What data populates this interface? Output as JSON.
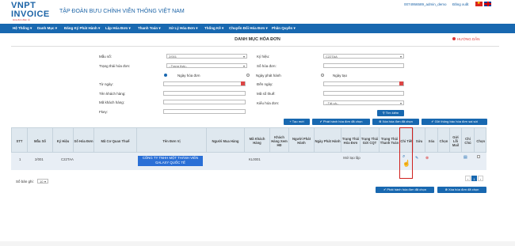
{
  "header": {
    "logo_line1": "VNPT",
    "logo_line2": "INVOICE",
    "logo_sub": "Hóa đơn điện tử",
    "company": "TẬP ĐOÀN BƯU CHÍNH VIỄN THÔNG VIỆT NAM",
    "user": "0074956589_admin_demo",
    "logout": "Đăng xuất"
  },
  "nav": {
    "items": [
      "Hệ Thống ▾",
      "Danh Mục ▾",
      "Đăng Ký Phát Hành ▾",
      "Lập Hóa Đơn ▾",
      "Thanh Toán ▾",
      "Xử Lý Hóa Đơn ▾",
      "Thống Kê ▾",
      "Chuyển Đổi Hóa Đơn ▾",
      "Phân Quyền ▾"
    ]
  },
  "page": {
    "title": "DANH MỤC HÓA ĐƠN",
    "help": "HƯỚNG DẪN"
  },
  "form": {
    "mau_so_label": "Mẫu số:",
    "mau_so_value": "2/001",
    "trang_thai_label": "Trạng thái hóa đơn:",
    "trang_thai_value": "--Trạng thái--",
    "radio_ngay_hoa_don": "Ngày hóa đơn",
    "radio_ngay_phat_hanh": "Ngày phát hành",
    "radio_ngay_tao": "Ngày tạo",
    "tu_ngay_label": "Từ ngày:",
    "ten_khach_hang_label": "Tên khách hàng:",
    "ma_khach_hang_label": "Mã khách hàng:",
    "fkey_label": "Fkey:",
    "ky_hieu_label": "Ký hiệu:",
    "ky_hieu_value": "C22TAA",
    "so_hoa_don_label": "Số hóa đơn:",
    "den_ngay_label": "Đến ngày:",
    "ma_so_thue_label": "Mã số thuế:",
    "kieu_hoa_don_label": "Kiểu hóa đơn:",
    "kieu_hoa_don_value": "--Tất cả--",
    "search_button": "Tìm kiếm"
  },
  "actions": {
    "tao_moi": "Tạo mới",
    "phat_hanh_da_chon": "Phát hành hóa đơn đã chọn",
    "xoa_da_chon": "Xóa hóa đơn đã chọn",
    "gui_thong_bao": "Gửi thông báo hóa đơn sai sót"
  },
  "table": {
    "headers": [
      "STT",
      "Mẫu Số",
      "Ký Hiệu",
      "Số Hóa Đơn",
      "Mã Cơ Quan Thuế",
      "Tên Đơn Vị",
      "Người Mua Hàng",
      "Mã Khách Hàng",
      "Khách Hàng Xem HĐ",
      "Người Phát Hành",
      "Ngày Phát Hành",
      "Trạng Thái Hóa Đơn",
      "Trạng Thái Gửi CQT",
      "Trạng Thái Thanh Toán",
      "Chi Tiết",
      "Sửa",
      "Xóa",
      "Chọn",
      "Gửi Lỗi Mail",
      "Chi Chú",
      "Chọn"
    ],
    "rows": [
      {
        "stt": "1",
        "mau_so": "2/001",
        "ky_hieu": "C22TAA",
        "ten_don_vi": "CÔNG TY TNHH MỘT THÀNH VIÊN GALAXY QUỐC TẾ",
        "ma_khach_hang": "KL0001",
        "trang_thai": "Mới tạo lập"
      }
    ]
  },
  "footer": {
    "so_ban_ghi_label": "Số bản ghi:",
    "so_ban_ghi_value": "10",
    "page_prev": "‹",
    "page_current": "1",
    "page_next": "›",
    "phat_hanh_da_chon": "Phát hành hóa đơn đã chọn",
    "xoa_da_chon": "Xóa hóa đơn đã chọn"
  },
  "colors": {
    "primary": "#1868b0",
    "highlight_box": "#d0201d",
    "selection": "#2a6fd6"
  }
}
